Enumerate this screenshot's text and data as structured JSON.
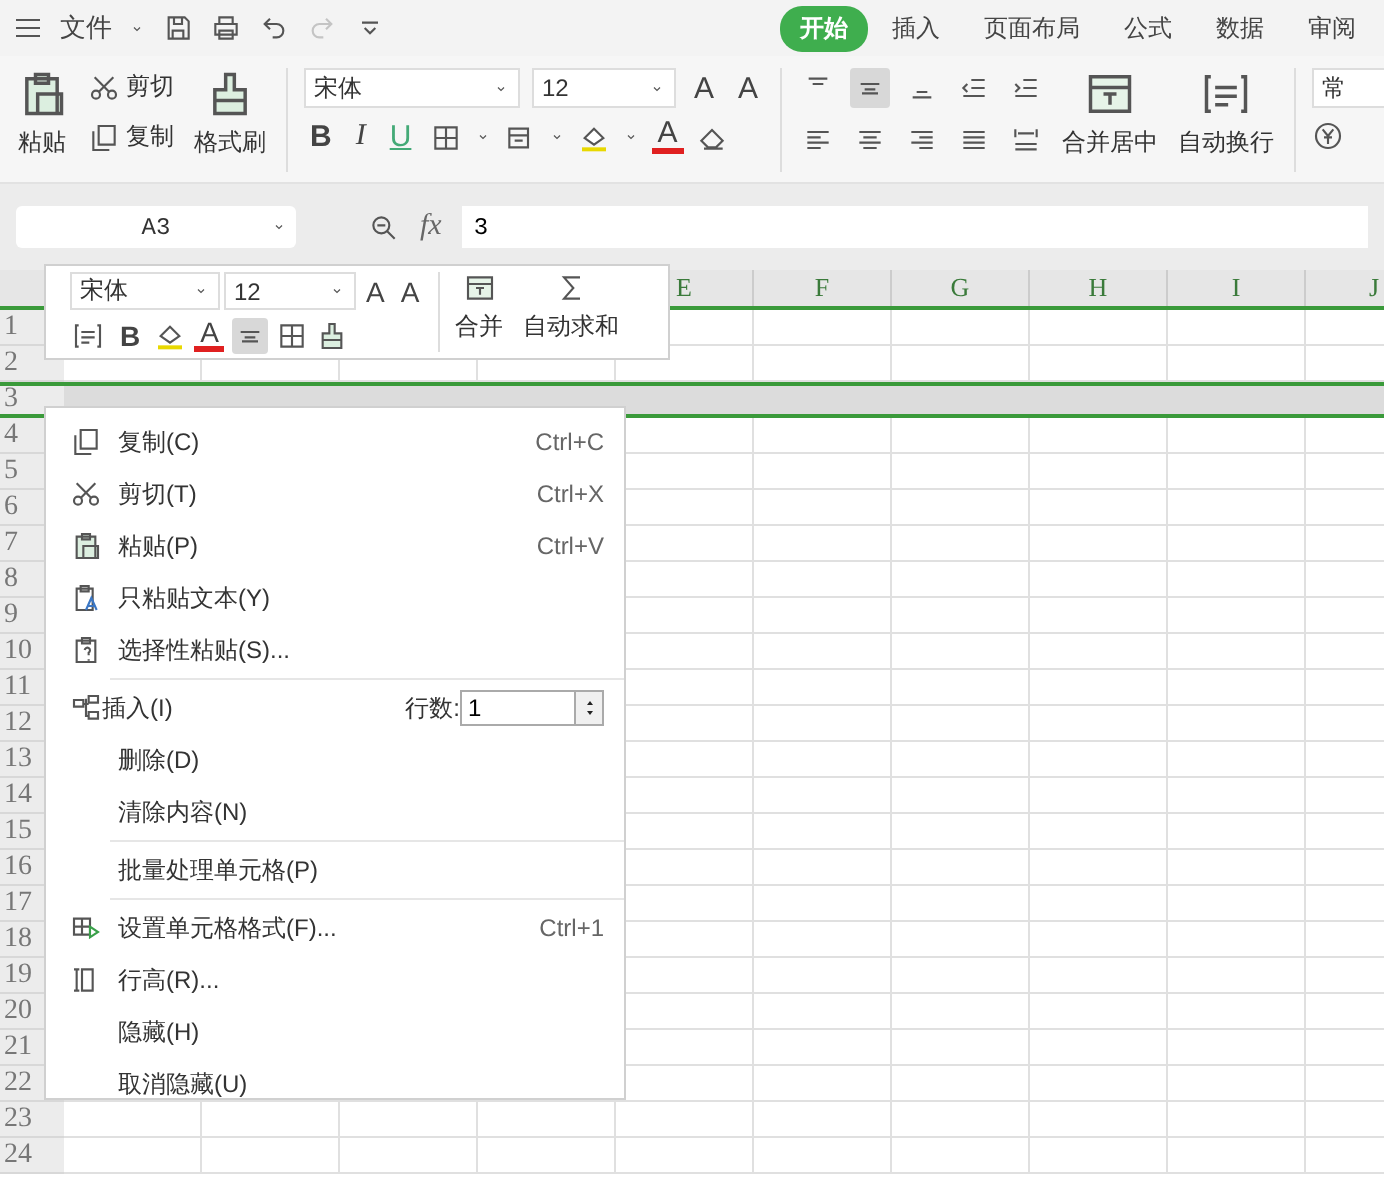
{
  "topbar": {
    "file_menu": "文件",
    "redo_disabled": true,
    "tabs": [
      {
        "label": "开始",
        "selected": true
      },
      {
        "label": "插入",
        "selected": false
      },
      {
        "label": "页面布局",
        "selected": false
      },
      {
        "label": "公式",
        "selected": false
      },
      {
        "label": "数据",
        "selected": false
      },
      {
        "label": "审阅",
        "selected": false
      }
    ]
  },
  "ribbon": {
    "paste": "粘贴",
    "cut": "剪切",
    "copy": "复制",
    "format_painter": "格式刷",
    "font": {
      "name": "宋体",
      "size": "12",
      "grow": "A",
      "shrink": "A",
      "bold": "B",
      "italic": "I",
      "underline": "U",
      "font_color": "A"
    },
    "align_buttons": [
      {
        "selected": false
      },
      {
        "selected": true
      },
      {
        "selected": false
      },
      {
        "selected": false
      },
      {
        "selected": false
      }
    ],
    "merge": "合并居中",
    "wrap": "自动换行",
    "number_format": "常"
  },
  "formula_bar": {
    "cell": "A3",
    "fx": "fx",
    "value": "3"
  },
  "sheet": {
    "columns": [
      "E",
      "F",
      "G",
      "H",
      "I",
      "J"
    ],
    "rows": [
      {
        "label": "1",
        "selected": false
      },
      {
        "label": "2",
        "selected": false
      },
      {
        "label": "3",
        "selected": true
      },
      {
        "label": "4",
        "selected": false
      },
      {
        "label": "5",
        "selected": false
      },
      {
        "label": "6",
        "selected": false
      },
      {
        "label": "7",
        "selected": false
      },
      {
        "label": "8",
        "selected": false
      },
      {
        "label": "9",
        "selected": false
      },
      {
        "label": "10",
        "selected": false
      },
      {
        "label": "11",
        "selected": false
      },
      {
        "label": "12",
        "selected": false
      },
      {
        "label": "13",
        "selected": false
      },
      {
        "label": "14",
        "selected": false
      },
      {
        "label": "15",
        "selected": false
      },
      {
        "label": "16",
        "selected": false
      },
      {
        "label": "17",
        "selected": false
      },
      {
        "label": "18",
        "selected": false
      },
      {
        "label": "19",
        "selected": false
      },
      {
        "label": "20",
        "selected": false
      },
      {
        "label": "21",
        "selected": false
      },
      {
        "label": "22",
        "selected": false
      },
      {
        "label": "23",
        "selected": false
      },
      {
        "label": "24",
        "selected": false
      }
    ]
  },
  "mini_toolbar": {
    "font": "宋体",
    "size": "12",
    "grow": "A",
    "shrink": "A",
    "bold": "B",
    "font_color": "A",
    "align_selected": true,
    "merge": "合并",
    "autosum": "自动求和"
  },
  "context_menu": [
    {
      "kind": "item",
      "label": "复制(C)",
      "shortcut": "Ctrl+C"
    },
    {
      "kind": "item",
      "label": "剪切(T)",
      "shortcut": "Ctrl+X"
    },
    {
      "kind": "item",
      "label": "粘贴(P)",
      "shortcut": "Ctrl+V"
    },
    {
      "kind": "item",
      "label": "只粘贴文本(Y)"
    },
    {
      "kind": "item",
      "label": "选择性粘贴(S)..."
    },
    {
      "kind": "separator"
    },
    {
      "kind": "insert",
      "label": "插入(I)",
      "count_label": "行数:",
      "count": "1"
    },
    {
      "kind": "item",
      "label": "删除(D)"
    },
    {
      "kind": "item",
      "label": "清除内容(N)"
    },
    {
      "kind": "separator"
    },
    {
      "kind": "item",
      "label": "批量处理单元格(P)"
    },
    {
      "kind": "separator"
    },
    {
      "kind": "item",
      "label": "设置单元格格式(F)...",
      "shortcut": "Ctrl+1"
    },
    {
      "kind": "item",
      "label": "行高(R)..."
    },
    {
      "kind": "item",
      "label": "隐藏(H)"
    },
    {
      "kind": "item",
      "label": "取消隐藏(U)"
    }
  ]
}
